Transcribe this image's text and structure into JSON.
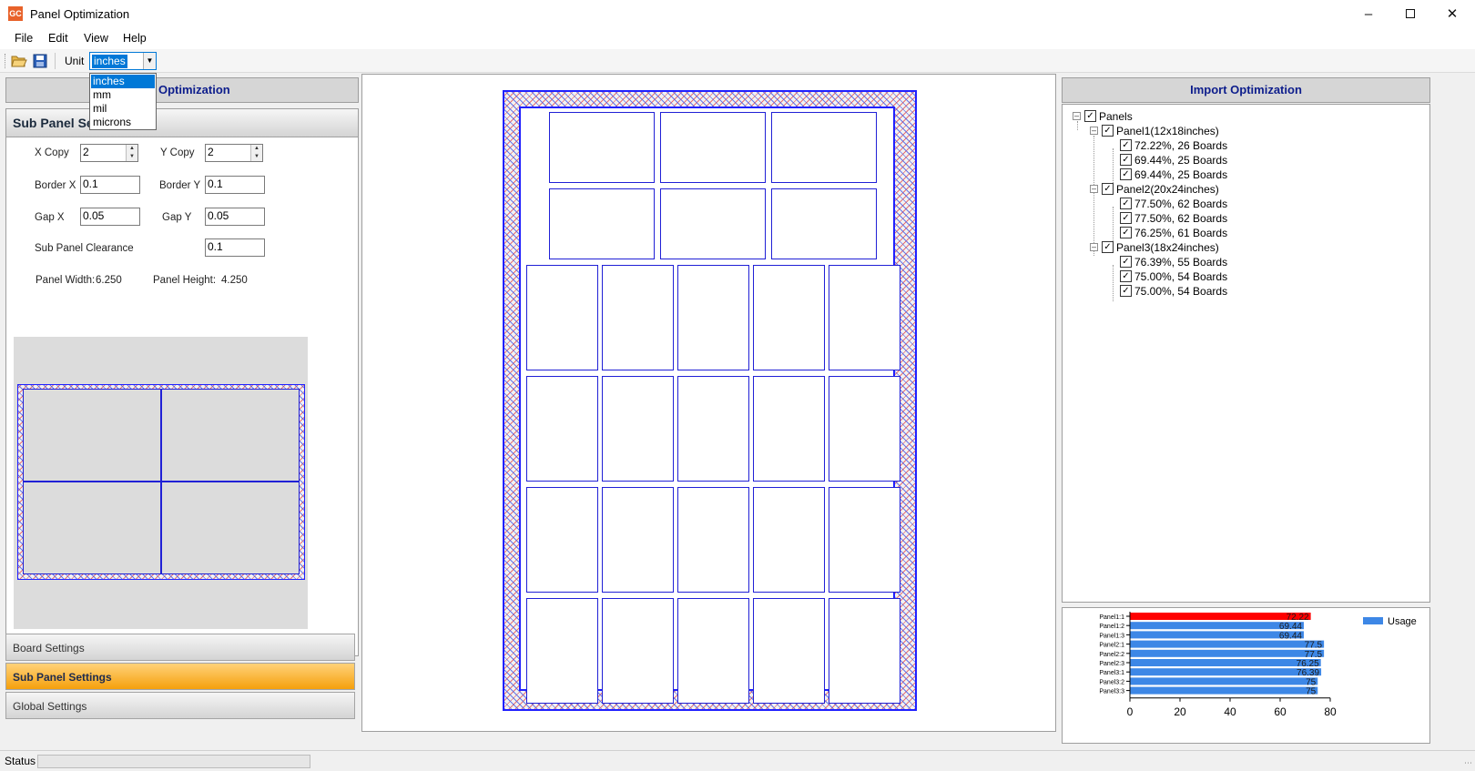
{
  "window": {
    "title": "Panel Optimization",
    "logo_text": "GC"
  },
  "menu": [
    "File",
    "Edit",
    "View",
    "Help"
  ],
  "toolbar": {
    "unit_label": "Unit",
    "unit_value": "inches",
    "unit_options": [
      "inches",
      "mm",
      "mil",
      "microns"
    ]
  },
  "left_panel": {
    "header": "Panel Optimization",
    "header_visible": "Optimization",
    "section_title": "Sub Panel Settings",
    "section_title_visible": "Sub Panel Se",
    "fields": {
      "x_copy": {
        "label": "X Copy",
        "value": "2"
      },
      "y_copy": {
        "label": "Y Copy",
        "value": "2"
      },
      "border_x": {
        "label": "Border X",
        "value": "0.1"
      },
      "border_y": {
        "label": "Border Y",
        "value": "0.1"
      },
      "gap_x": {
        "label": "Gap X",
        "value": "0.05"
      },
      "gap_y": {
        "label": "Gap Y",
        "value": "0.05"
      },
      "clearance": {
        "label": "Sub Panel Clearance",
        "value": "0.1"
      }
    },
    "panel_width": {
      "label": "Panel Width:",
      "value": "6.250"
    },
    "panel_height": {
      "label": "Panel Height:",
      "value": "4.250"
    },
    "nav": {
      "board": "Board Settings",
      "sub_panel": "Sub Panel Settings",
      "global": "Global Settings"
    }
  },
  "right_panel": {
    "header": "Import Optimization",
    "tree": {
      "root": "Panels",
      "panels": [
        {
          "label": "Panel1(12x18inches)",
          "options": [
            "72.22%, 26 Boards",
            "69.44%, 25 Boards",
            "69.44%, 25 Boards"
          ]
        },
        {
          "label": "Panel2(20x24inches)",
          "options": [
            "77.50%, 62 Boards",
            "77.50%, 62 Boards",
            "76.25%, 61 Boards"
          ]
        },
        {
          "label": "Panel3(18x24inches)",
          "options": [
            "76.39%, 55 Boards",
            "75.00%, 54 Boards",
            "75.00%, 54 Boards"
          ]
        }
      ]
    }
  },
  "status": {
    "label": "Status"
  },
  "colors": {
    "accent": "#0078d7",
    "board_line": "#2020ff",
    "bar": "#3d87e6",
    "bar_highlight": "#ff0000",
    "nav_active": "#f5a00c",
    "header_text": "#0d1d8c"
  },
  "chart_data": {
    "type": "bar",
    "orientation": "horizontal",
    "categories": [
      "Panel1:1",
      "Panel1:2",
      "Panel1:3",
      "Panel2:1",
      "Panel2:2",
      "Panel2:3",
      "Panel3:1",
      "Panel3:2",
      "Panel3:3"
    ],
    "series": [
      {
        "name": "Usage",
        "values": [
          72.22,
          69.44,
          69.44,
          77.5,
          77.5,
          76.25,
          76.39,
          75,
          75
        ]
      }
    ],
    "data_labels": [
      "72.22",
      "69.44",
      "69.44",
      "77.5",
      "77.5",
      "76.25",
      "76.39",
      "75",
      "75"
    ],
    "highlighted_index": 0,
    "xlim": [
      0,
      80
    ],
    "xticks": [
      0,
      20,
      40,
      60,
      80
    ],
    "legend": "top-right",
    "grid": false
  }
}
